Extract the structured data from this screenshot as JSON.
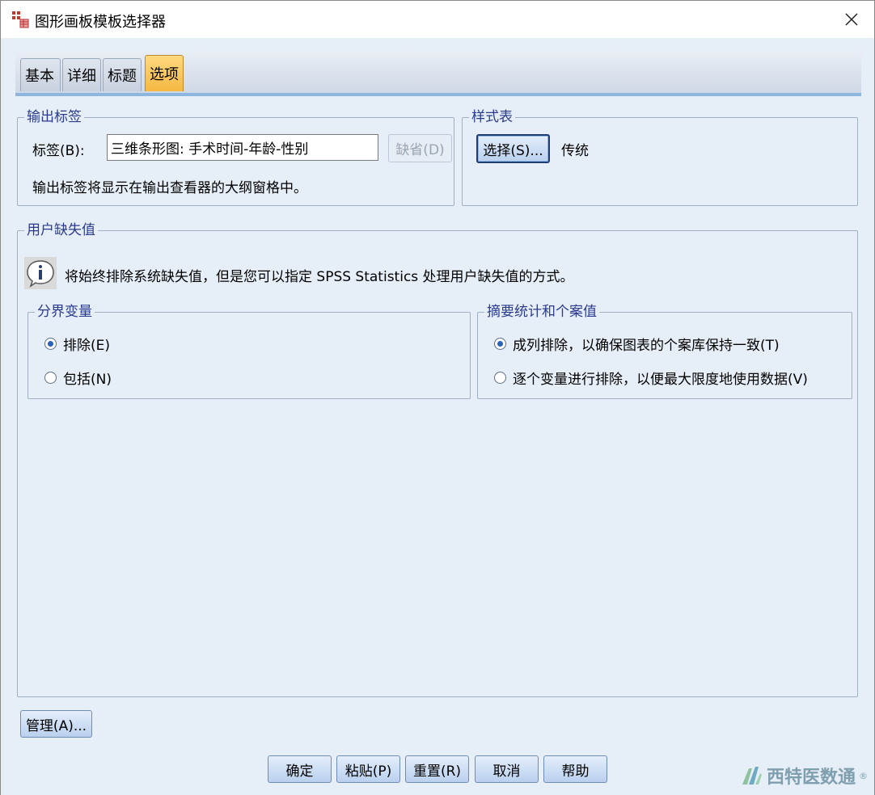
{
  "window": {
    "title": "图形画板模板选择器",
    "close_glyph": "✕"
  },
  "tabs": [
    {
      "label": "基本",
      "active": false
    },
    {
      "label": "详细",
      "active": false
    },
    {
      "label": "标题",
      "active": false
    },
    {
      "label": "选项",
      "active": true
    }
  ],
  "output_label": {
    "group_title": "输出标签",
    "field_label": "标签(B):",
    "value": "三维条形图: 手术时间-年龄-性别",
    "default_button": "缺省(D)",
    "description": "输出标签将显示在输出查看器的大纲窗格中。"
  },
  "stylesheet": {
    "group_title": "样式表",
    "select_button": "选择(S)...",
    "current": "传统"
  },
  "user_missing": {
    "group_title": "用户缺失值",
    "info_text": "将始终排除系统缺失值，但是您可以指定 SPSS Statistics 处理用户缺失值的方式。",
    "break_variables": {
      "group_title": "分界变量",
      "options": [
        {
          "label": "排除(E)",
          "checked": true
        },
        {
          "label": "包括(N)",
          "checked": false
        }
      ]
    },
    "summary_stats": {
      "group_title": "摘要统计和个案值",
      "options": [
        {
          "label": "成列排除，以确保图表的个案库保持一致(T)",
          "checked": true
        },
        {
          "label": "逐个变量进行排除，以便最大限度地使用数据(V)",
          "checked": false
        }
      ]
    }
  },
  "manage_button": "管理(A)...",
  "footer_buttons": {
    "ok": "确定",
    "paste": "粘贴(P)",
    "reset": "重置(R)",
    "cancel": "取消",
    "help": "帮助"
  },
  "watermark": {
    "text": "西特医数通",
    "mark": "®"
  },
  "colors": {
    "accent_tab": "#f6b841",
    "group_label": "#2a3b8f",
    "radio_dot": "#2a62b8"
  }
}
